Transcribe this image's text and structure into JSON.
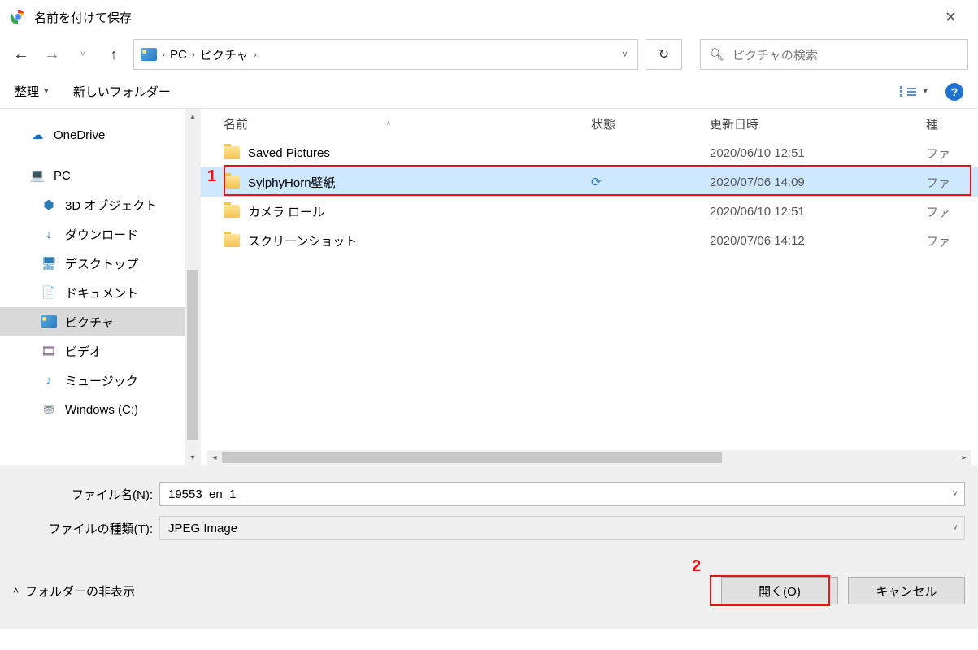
{
  "title": "名前を付けて保存",
  "breadcrumb": {
    "root": "PC",
    "folder": "ピクチャ"
  },
  "search_placeholder": "ピクチャの検索",
  "toolbar": {
    "organize": "整理",
    "new_folder": "新しいフォルダー"
  },
  "sidebar": {
    "onedrive": "OneDrive",
    "pc": "PC",
    "items": [
      "3D オブジェクト",
      "ダウンロード",
      "デスクトップ",
      "ドキュメント",
      "ピクチャ",
      "ビデオ",
      "ミュージック",
      "Windows (C:)"
    ]
  },
  "columns": {
    "name": "名前",
    "status": "状態",
    "date": "更新日時",
    "type": "種"
  },
  "rows": [
    {
      "name": "Saved Pictures",
      "status": "",
      "date": "2020/06/10 12:51",
      "type": "ファ"
    },
    {
      "name": "SylphyHorn壁紙",
      "status": "sync",
      "date": "2020/07/06 14:09",
      "type": "ファ"
    },
    {
      "name": "カメラ ロール",
      "status": "",
      "date": "2020/06/10 12:51",
      "type": "ファ"
    },
    {
      "name": "スクリーンショット",
      "status": "",
      "date": "2020/07/06 14:12",
      "type": "ファ"
    }
  ],
  "filename_label": "ファイル名(N):",
  "filetype_label": "ファイルの種類(T):",
  "filename_value": "19553_en_1",
  "filetype_value": "JPEG Image",
  "hide_folders": "フォルダーの非表示",
  "open_btn": "開く(O)",
  "cancel_btn": "キャンセル",
  "annotations": {
    "a1": "1",
    "a2": "2"
  }
}
